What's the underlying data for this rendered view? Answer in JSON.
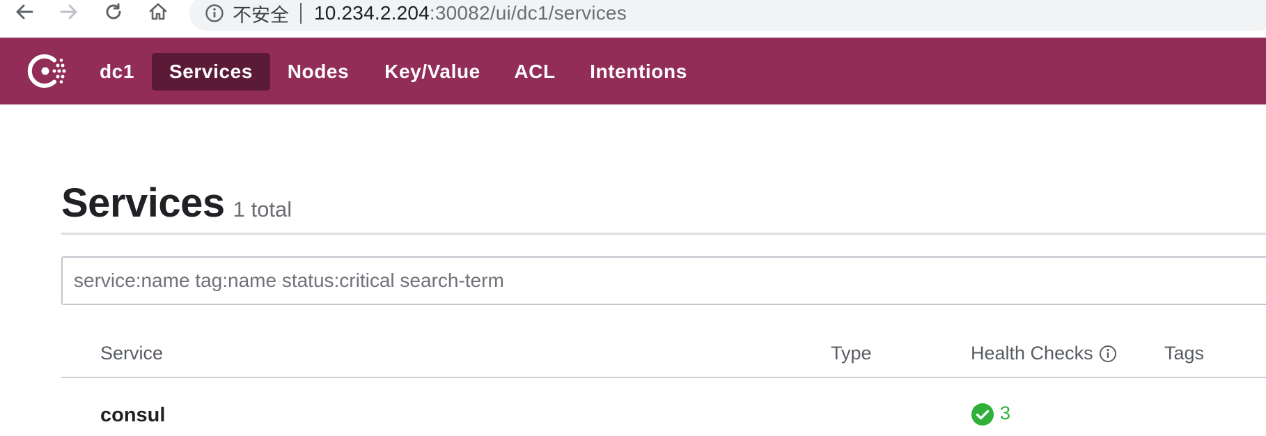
{
  "browser": {
    "security_label": "不安全",
    "url_host": "10.234.2.204",
    "url_rest": ":30082/ui/dc1/services"
  },
  "nav": {
    "datacenter": "dc1",
    "items": [
      {
        "label": "Services",
        "active": true
      },
      {
        "label": "Nodes"
      },
      {
        "label": "Key/Value"
      },
      {
        "label": "ACL"
      },
      {
        "label": "Intentions"
      }
    ]
  },
  "page": {
    "title": "Services",
    "count": "1 total"
  },
  "search": {
    "placeholder": "service:name tag:name status:critical search-term",
    "value": ""
  },
  "table": {
    "columns": [
      "Service",
      "Type",
      "Health Checks",
      "Tags"
    ],
    "rows": [
      {
        "service": "consul",
        "type": "",
        "health_passing": "3",
        "tags": ""
      }
    ]
  },
  "colors": {
    "brand": "#912d56",
    "nav_active": "#5b1a36",
    "passing": "#2eb039"
  },
  "icons": [
    "back-arrow-icon",
    "forward-arrow-icon",
    "reload-icon",
    "home-icon",
    "info-icon",
    "consul-logo",
    "health-info-icon",
    "check-circle-icon"
  ]
}
